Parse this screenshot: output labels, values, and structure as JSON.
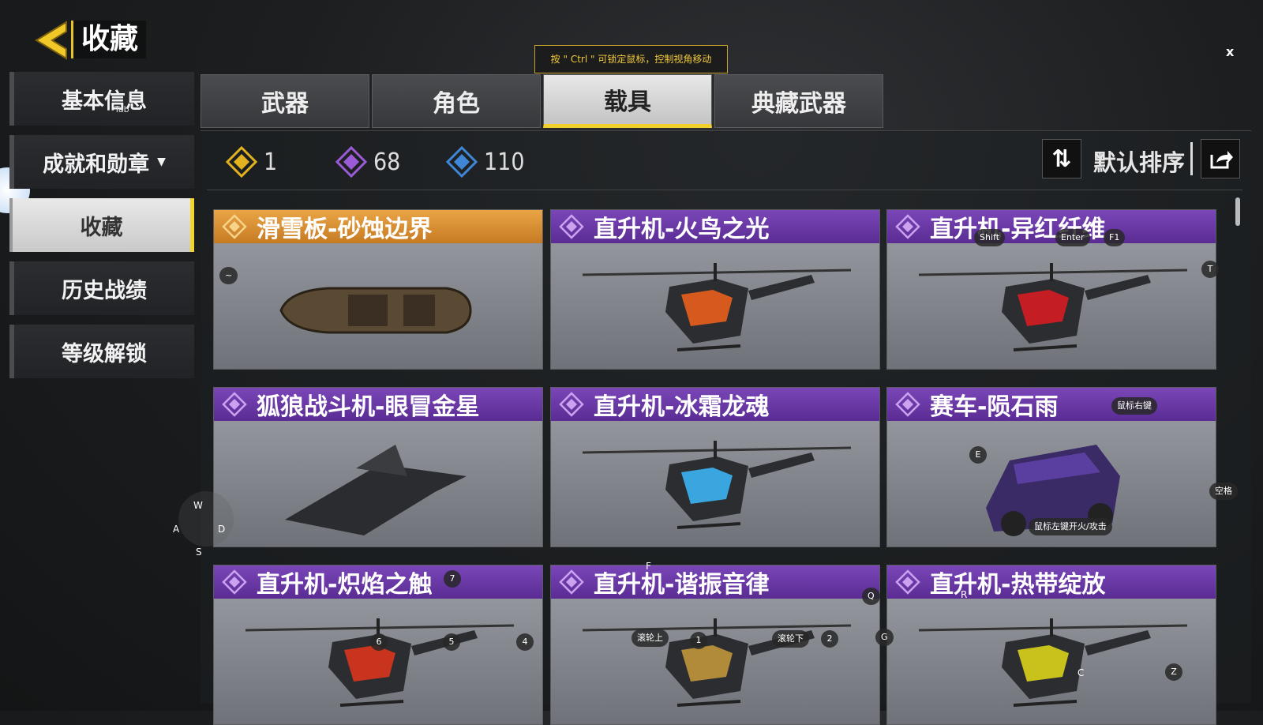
{
  "header": {
    "title": "收藏",
    "hint": "按 \" Ctrl \" 可锁定鼠标，控制视角移动",
    "close": "x"
  },
  "sidebar": {
    "items": [
      {
        "label": "基本信息",
        "active": false
      },
      {
        "label": "成就和勋章",
        "active": false,
        "dropdown": true
      },
      {
        "label": "收藏",
        "active": true
      },
      {
        "label": "历史战绩",
        "active": false
      },
      {
        "label": "等级解锁",
        "active": false
      }
    ],
    "tab_key": "Tab"
  },
  "tabs": [
    {
      "label": "武器",
      "active": false
    },
    {
      "label": "角色",
      "active": false
    },
    {
      "label": "载具",
      "active": true
    },
    {
      "label": "典藏武器",
      "active": false
    }
  ],
  "counts": [
    {
      "rarity": "gold",
      "value": "1",
      "color": "#e3b21f"
    },
    {
      "rarity": "purple",
      "value": "68",
      "color": "#9b5bd6"
    },
    {
      "rarity": "blue",
      "value": "110",
      "color": "#3f86d6"
    }
  ],
  "sort": {
    "label": "默认排序",
    "icon": "sort-icon",
    "share_icon": "share-icon"
  },
  "cards": [
    {
      "name": "滑雪板-砂蚀边界",
      "rarity": "gold",
      "vehicle": "snowboard"
    },
    {
      "name": "直升机-火鸟之光",
      "rarity": "purple",
      "vehicle": "helicopter",
      "color": "#d65a1e"
    },
    {
      "name": "直升机-异红纤维",
      "rarity": "purple",
      "vehicle": "helicopter",
      "color": "#c51d24"
    },
    {
      "name": "狐狼战斗机-眼冒金星",
      "rarity": "purple",
      "vehicle": "jet"
    },
    {
      "name": "直升机-冰霜龙魂",
      "rarity": "purple",
      "vehicle": "helicopter",
      "color": "#3aa6e0"
    },
    {
      "name": "赛车-陨石雨",
      "rarity": "purple",
      "vehicle": "car"
    },
    {
      "name": "直升机-炽焰之触",
      "rarity": "purple",
      "vehicle": "helicopter",
      "color": "#c8341e"
    },
    {
      "name": "直升机-谐振音律",
      "rarity": "purple",
      "vehicle": "helicopter",
      "color": "#b18a3a"
    },
    {
      "name": "直升机-热带绽放",
      "rarity": "purple",
      "vehicle": "helicopter",
      "color": "#c9c21d"
    }
  ],
  "key_hints": {
    "tilde": "~",
    "shift": "Shift",
    "enter": "Enter",
    "f1": "F1",
    "t": "T",
    "right_mouse": "鼠标右键",
    "e": "E",
    "space": "空格",
    "left_mouse": "鼠标左键开火/攻击",
    "w": "W",
    "a": "A",
    "s": "S",
    "d": "D",
    "f": "F",
    "seven": "7",
    "q": "Q",
    "r": "R",
    "g": "G",
    "six": "6",
    "five": "5",
    "four": "4",
    "scroll_up": "滚轮上",
    "one": "1",
    "scroll_down": "滚轮下",
    "two": "2",
    "c": "C",
    "z": "Z"
  }
}
